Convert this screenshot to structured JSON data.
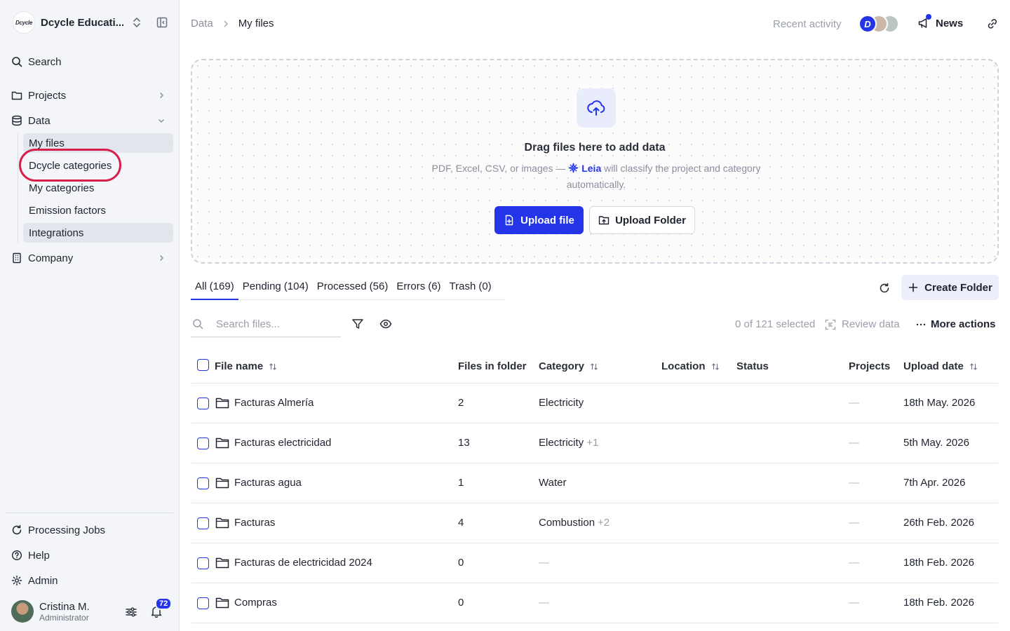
{
  "org": {
    "logo_text": "Dcycle",
    "name": "Dcycle Educati..."
  },
  "sidebar": {
    "search_label": "Search",
    "projects_label": "Projects",
    "data_label": "Data",
    "sub_items": [
      {
        "label": "My files",
        "active": true
      },
      {
        "label": "Dcycle categories",
        "active": false,
        "highlighted": true
      },
      {
        "label": "My categories",
        "active": false
      },
      {
        "label": "Emission factors",
        "active": false
      },
      {
        "label": "Integrations",
        "active": true
      }
    ],
    "company_label": "Company",
    "bottom": {
      "processing_jobs": "Processing Jobs",
      "help": "Help",
      "admin": "Admin"
    },
    "user": {
      "name": "Cristina M.",
      "role": "Administrator",
      "notifications": "72"
    }
  },
  "header": {
    "breadcrumb": [
      "Data",
      "My files"
    ],
    "recent_activity": "Recent activity",
    "avatar_initial": "D",
    "news": "News"
  },
  "dropzone": {
    "title": "Drag files here to add data",
    "subtitle_before": "PDF, Excel, CSV, or images —",
    "leia": "Leia",
    "subtitle_after": "will classify the project and category automatically.",
    "upload_file": "Upload file",
    "upload_folder": "Upload Folder"
  },
  "tabs": [
    {
      "label": "All",
      "count": "(169)",
      "active": true
    },
    {
      "label": "Pending",
      "count": "(104)",
      "active": false
    },
    {
      "label": "Processed",
      "count": "(56)",
      "active": false
    },
    {
      "label": "Errors",
      "count": "(6)",
      "active": false
    },
    {
      "label": "Trash",
      "count": "(0)",
      "active": false
    }
  ],
  "create_folder": "Create Folder",
  "toolbar": {
    "search_placeholder": "Search files...",
    "selected": "0 of 121 selected",
    "review": "Review data",
    "more": "More actions"
  },
  "table": {
    "headers": {
      "file_name": "File name",
      "files_in_folder": "Files in folder",
      "category": "Category",
      "location": "Location",
      "status": "Status",
      "projects": "Projects",
      "upload_date": "Upload date"
    },
    "rows": [
      {
        "name": "Facturas Almería",
        "files": "2",
        "category": "Electricity",
        "extra": "",
        "projects": "—",
        "date": "18th May. 2026"
      },
      {
        "name": "Facturas electricidad",
        "files": "13",
        "category": "Electricity",
        "extra": "+1",
        "projects": "—",
        "date": "5th May. 2026"
      },
      {
        "name": "Facturas agua",
        "files": "1",
        "category": "Water",
        "extra": "",
        "projects": "—",
        "date": "7th Apr. 2026"
      },
      {
        "name": "Facturas",
        "files": "4",
        "category": "Combustion",
        "extra": "+2",
        "projects": "—",
        "date": "26th Feb. 2026"
      },
      {
        "name": "Facturas de electricidad 2024",
        "files": "0",
        "category": "—",
        "extra": "",
        "projects": "—",
        "date": "18th Feb. 2026"
      },
      {
        "name": "Compras",
        "files": "0",
        "category": "—",
        "extra": "",
        "projects": "—",
        "date": "18th Feb. 2026"
      }
    ]
  },
  "colors": {
    "accent": "#2434e8",
    "highlight": "#d61f4d",
    "sidebar_bg": "#f4f5f8"
  }
}
